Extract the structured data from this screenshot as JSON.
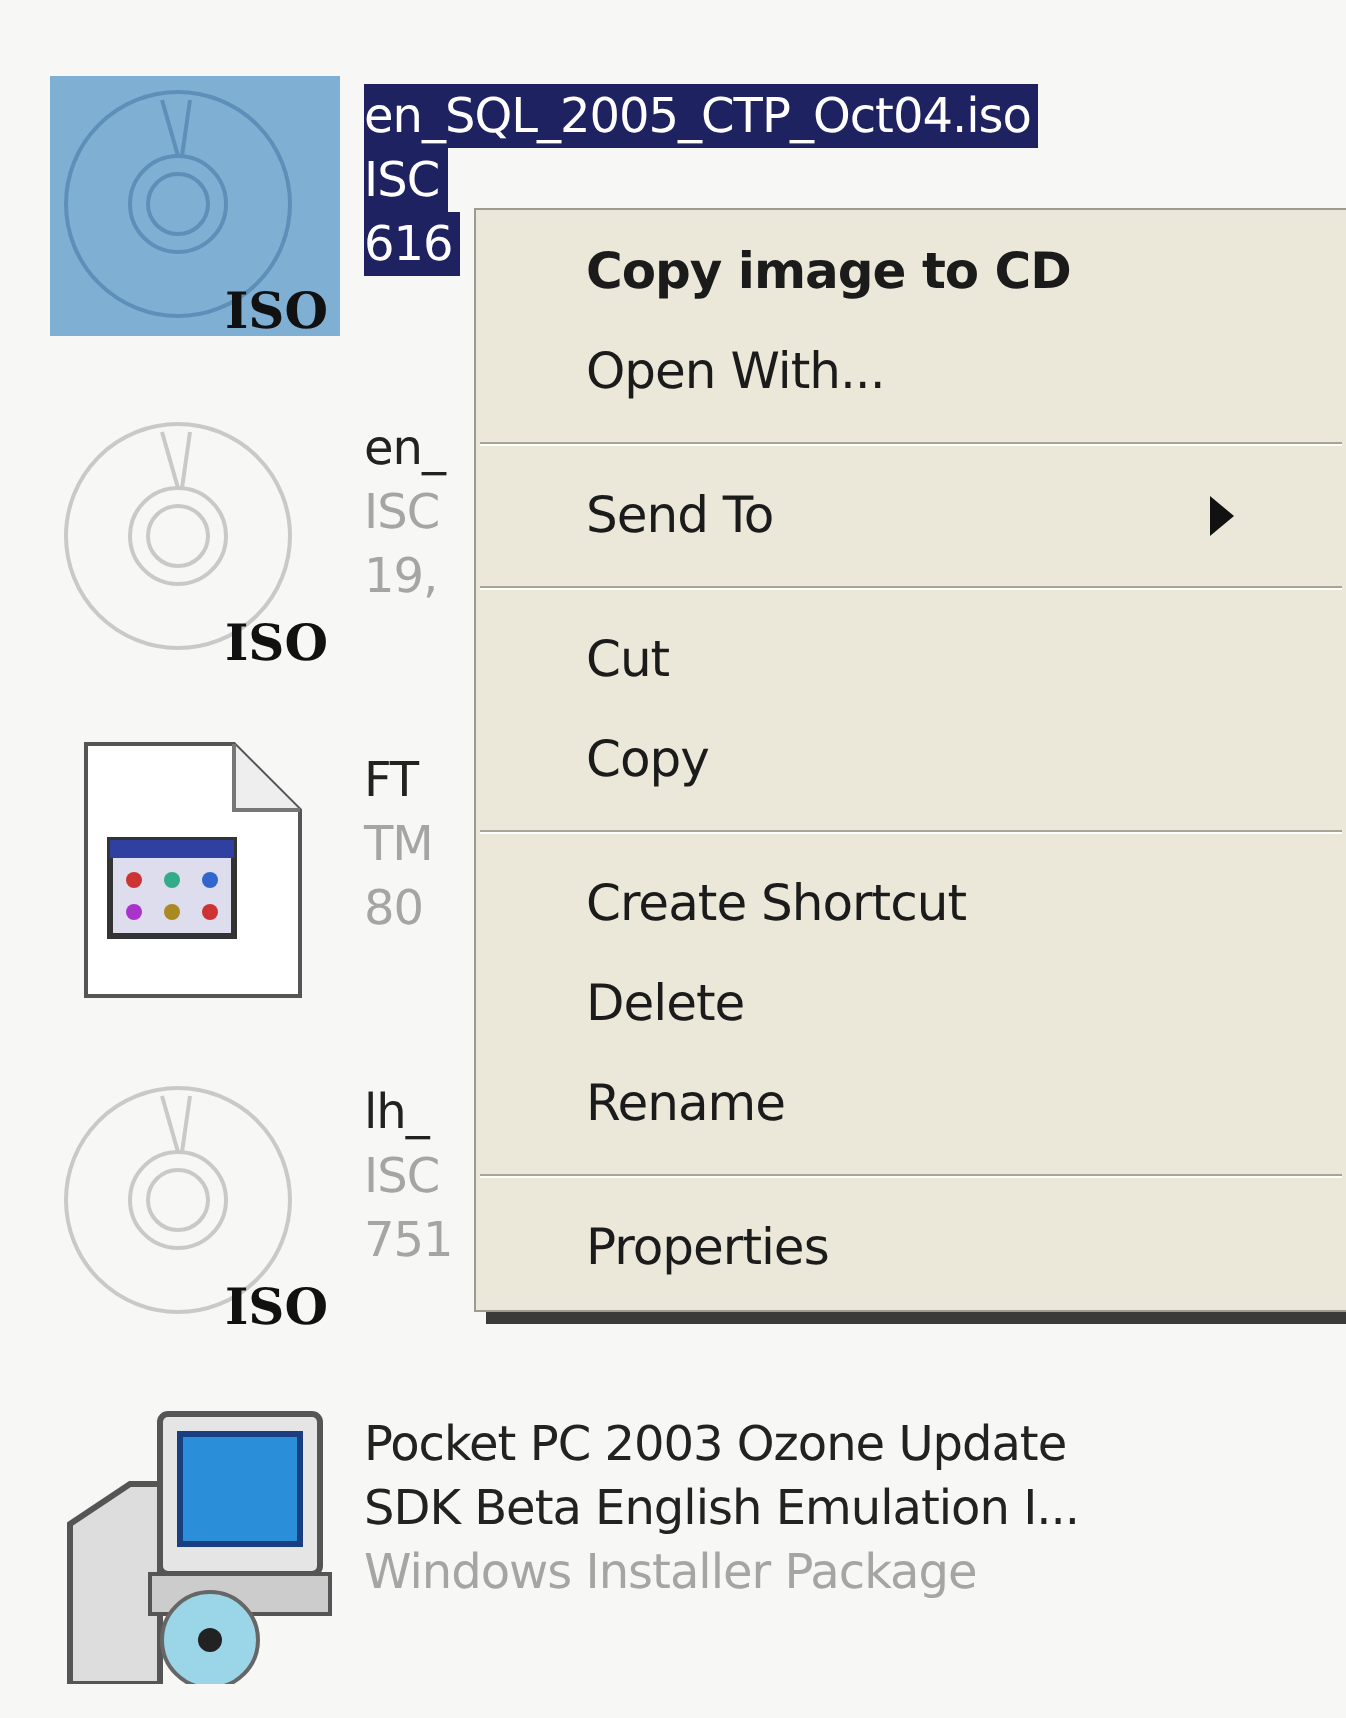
{
  "files": [
    {
      "kind": "iso",
      "icon_label": "ISO",
      "selected": true,
      "lines": [
        "en_SQL_2005_CTP_Oct04.iso",
        "ISC",
        "616"
      ]
    },
    {
      "kind": "iso",
      "icon_label": "ISO",
      "selected": false,
      "lines": [
        "en_",
        "ISC",
        "19,"
      ]
    },
    {
      "kind": "app",
      "selected": false,
      "lines": [
        "FT",
        "TM",
        "80"
      ]
    },
    {
      "kind": "iso",
      "icon_label": "ISO",
      "selected": false,
      "lines": [
        "lh_",
        "ISC",
        "751"
      ]
    },
    {
      "kind": "installer",
      "selected": false,
      "lines": [
        "Pocket PC 2003 Ozone Update",
        "SDK Beta English Emulation I...",
        "Windows Installer Package"
      ]
    }
  ],
  "context_menu": {
    "groups": [
      [
        {
          "label": "Copy image to CD",
          "default": true
        },
        {
          "label": "Open With...",
          "default": false
        }
      ],
      [
        {
          "label": "Send To",
          "default": false,
          "submenu": true
        }
      ],
      [
        {
          "label": "Cut",
          "default": false
        },
        {
          "label": "Copy",
          "default": false
        }
      ],
      [
        {
          "label": "Create Shortcut",
          "default": false
        },
        {
          "label": "Delete",
          "default": false
        },
        {
          "label": "Rename",
          "default": false
        }
      ],
      [
        {
          "label": "Properties",
          "default": false
        }
      ]
    ]
  }
}
